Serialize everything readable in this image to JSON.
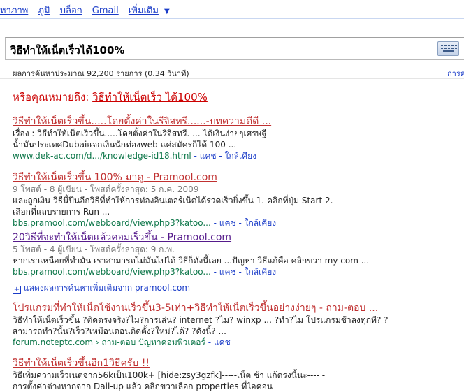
{
  "nav": {
    "items": [
      "หาภาพ",
      "ภูมิ",
      "บล็อก",
      "Gmail",
      "เพิ่มเติม"
    ],
    "more_arrow": "▼"
  },
  "search": {
    "query": "วิธีทำให้เน็ตเร็วได้100%"
  },
  "stats": {
    "text": "ผลการค้นหาประมาณ 92,200 รายการ (0.34 วินาที)",
    "right_cut": "การค"
  },
  "did_you_mean": {
    "prefix": "หรือคุณหมายถึง: ",
    "suggestion": "วิธีทำให้เน็ตเร็ว ได้100%"
  },
  "results": [
    {
      "title": "วิธีทำให้เน็ตเร็วขึ้น.....โดยตั้งค่าในรีจิสทรี......-บทความดีดี ...",
      "snippet1": "เรื่อง : วิธีทำให้เน็ตเร็วขึ้น.....โดยตั้งค่าในรีจิสทรี. ... ได้เงินง่ายๆเศรษฐี",
      "snippet2": "น้ำมันประเทศDubaiแจกเงินนักท่องweb แค่สมัครก็ได้ 100 ...",
      "url": "www.dek-ac.com/d.../knowledge-id18.html",
      "links": " - แคช - ใกล้เคียง"
    },
    {
      "title": "วิธีทำให้เน็ตเร็วขึ้น 100% มาดู - Pramool.com",
      "meta": "9 โพสต์ - 8 ผู้เขียน - โพสต์ครั้งล่าสุด: 5 ก.ค. 2009",
      "snippet1": "และถูกเงิน วิธีนี้ปีนอีกวิธีที่ทำให้การท่องอินเตอร์เน็ตได้รวดเร็วยิ่งขึ้น 1. คลิกที่ปุ่ม Start 2.",
      "snippet2": "เลือกที่แถบรายการ Run ...",
      "url": "bbs.pramool.com/webboard/view.php3?katoo...",
      "links": " - แคช - ใกล้เคียง"
    },
    {
      "title": "20วิธีที่จะทำให้เน็ตแล้วคอมเร็วขึ้น - Pramool.com",
      "meta": "5 โพสต์ - 4 ผู้เขียน - โพสต์ครั้งล่าสุด: 9 ก.พ.",
      "snippet1": "หากเราเหนื่อยที่ทำมัน เราสามารถไม่มันไปได้ วิธีก็ดังนี้เลย ...ปัญหา วิธีแก้คือ คลิกขวา my com ...",
      "url": "bbs.pramool.com/webboard/view.php3?katoo...",
      "links": " - แคช - ใกล้เคียง"
    },
    {
      "title": "โปรแกรมที่ทำให้เน็ตใช้งานเร็วขึ้น3-5เท่า+วิธีทำให้เน็ตเร็วขึ้นอย่างง่ายๆ - ถาม-ตอบ ...",
      "snippet1": "วิธีทำให้เน็ตเร็วขึ้น ?ติดตรงจริง?ไม?การเล่น? internet ?ไม? winxp ... ?ทำ?ไม โปรแกรมช้าลงทุกที? ?",
      "snippet2": "สามารถทำ?นั้น?เร็ว?เหมือนตอนติดตั้ง?ใหม่?ได้? ?ดังนี้? ...",
      "url": "forum.noteptc.com › ถาม-ตอบ ปัญหาคอมพิวเตอร์",
      "links": " - แคช"
    },
    {
      "title": "วิธีทำให้เน็ตเร็วขึ้นอีก1วิธีครับ !!",
      "snippet1": "วิธีเพิ่มความเร็วเนตจาก56kเป็น100k+ [hide:zsy3gzfk]-----เน็ต ช้า แก้ตรงนี้นะ---- -",
      "snippet2": "การตั้งค่าต่างหากจาก Dail-up แล้ว คลิกขวาเลือก properties ที่ไอคอน"
    }
  ],
  "more_from": "แสดงผลการค้นหาเพิ่มเติมจาก pramool.com",
  "colors": {
    "link": "#1a0dab",
    "visited": "#551a8b",
    "url": "#0e774a",
    "emphasis": "#cc0000"
  }
}
